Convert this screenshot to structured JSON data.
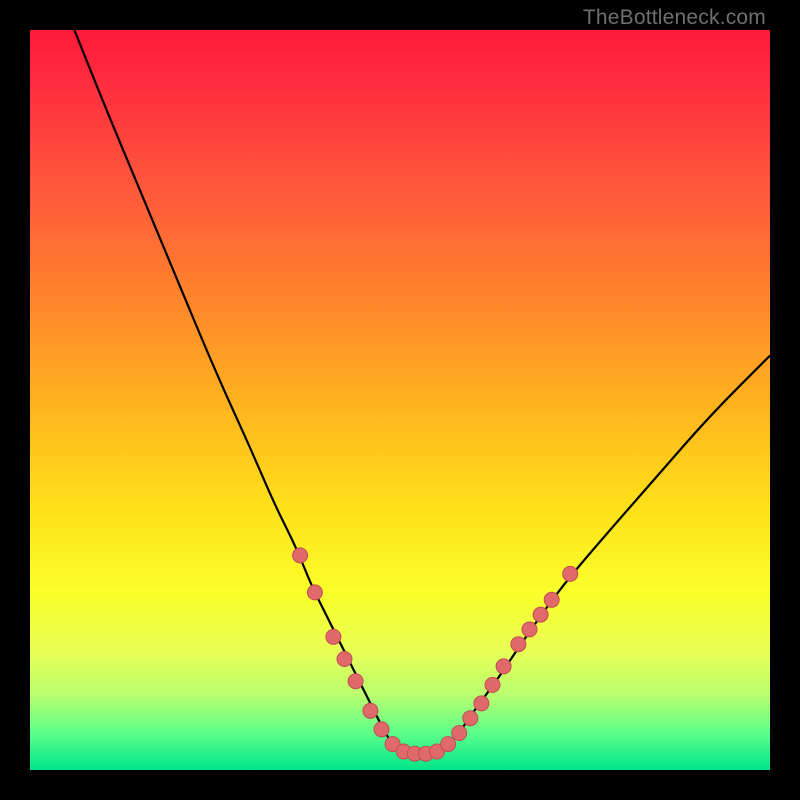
{
  "watermark": "TheBottleneck.com",
  "colors": {
    "frame": "#000000",
    "curve": "#000000",
    "marker_fill": "#e06a6a",
    "marker_stroke": "#c24c52",
    "gradient_top": "#ff1a3a",
    "gradient_bottom": "#00e58a"
  },
  "chart_data": {
    "type": "line",
    "title": "",
    "xlabel": "",
    "ylabel": "",
    "xlim": [
      0,
      100
    ],
    "ylim": [
      0,
      100
    ],
    "grid": false,
    "legend": false,
    "series": [
      {
        "name": "bottleneck-curve",
        "x": [
          6,
          10,
          15,
          20,
          25,
          30,
          33,
          36,
          38,
          40,
          42,
          44,
          46,
          47,
          48,
          49,
          50,
          52,
          54,
          55,
          56,
          58,
          60,
          63,
          67,
          72,
          78,
          85,
          92,
          100
        ],
        "y": [
          100,
          90,
          78,
          66,
          54,
          43,
          36,
          30,
          25,
          21,
          17,
          13,
          9,
          7,
          5,
          3.5,
          2.5,
          2,
          2,
          2.3,
          3,
          5,
          8,
          12,
          18,
          25,
          32,
          40,
          48,
          56
        ]
      }
    ],
    "markers": [
      {
        "x": 36.5,
        "y": 29
      },
      {
        "x": 38.5,
        "y": 24
      },
      {
        "x": 41,
        "y": 18
      },
      {
        "x": 42.5,
        "y": 15
      },
      {
        "x": 44,
        "y": 12
      },
      {
        "x": 46,
        "y": 8
      },
      {
        "x": 47.5,
        "y": 5.5
      },
      {
        "x": 49,
        "y": 3.5
      },
      {
        "x": 50.5,
        "y": 2.5
      },
      {
        "x": 52,
        "y": 2.2
      },
      {
        "x": 53.5,
        "y": 2.2
      },
      {
        "x": 55,
        "y": 2.5
      },
      {
        "x": 56.5,
        "y": 3.5
      },
      {
        "x": 58,
        "y": 5
      },
      {
        "x": 59.5,
        "y": 7
      },
      {
        "x": 61,
        "y": 9
      },
      {
        "x": 62.5,
        "y": 11.5
      },
      {
        "x": 64,
        "y": 14
      },
      {
        "x": 66,
        "y": 17
      },
      {
        "x": 67.5,
        "y": 19
      },
      {
        "x": 69,
        "y": 21
      },
      {
        "x": 70.5,
        "y": 23
      },
      {
        "x": 73,
        "y": 26.5
      }
    ]
  }
}
